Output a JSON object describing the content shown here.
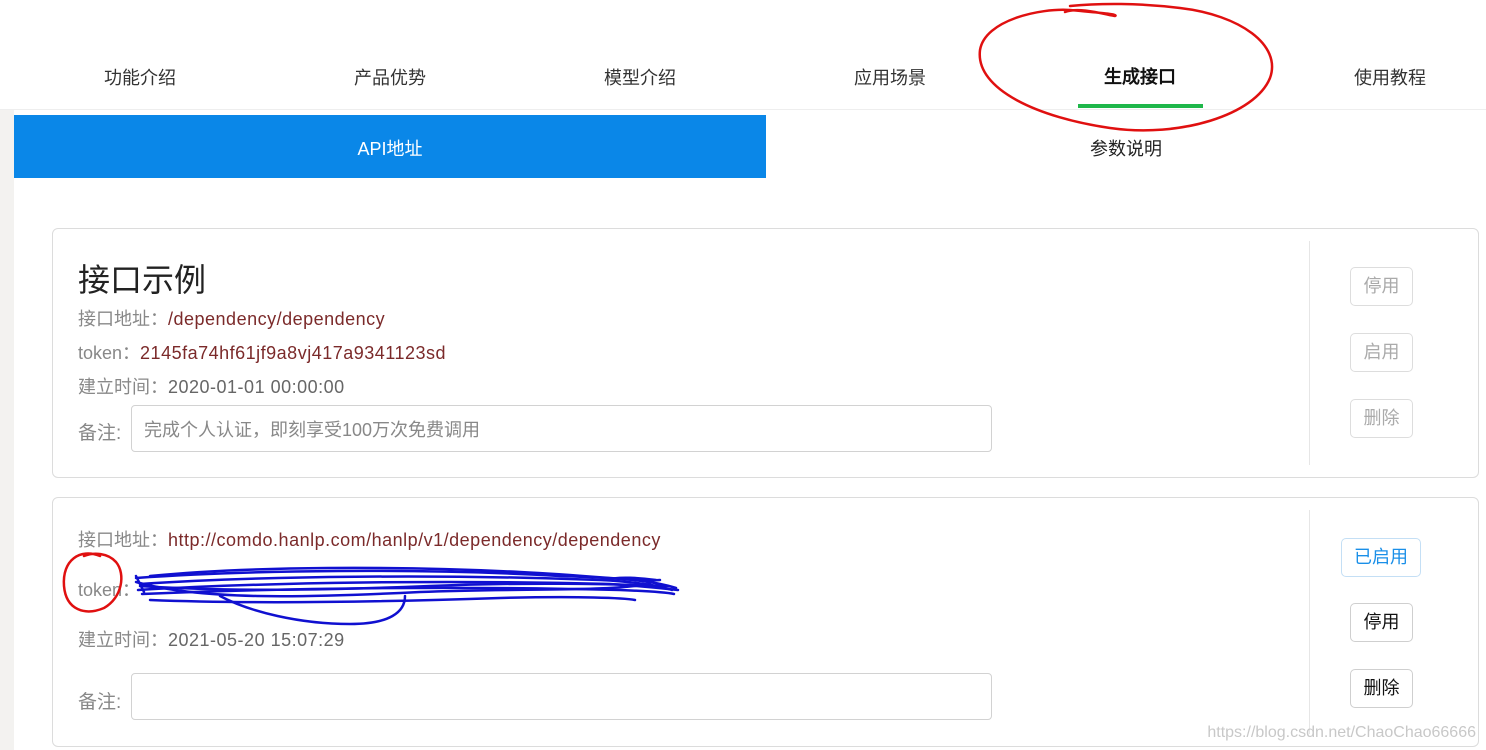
{
  "topnav": {
    "items": [
      {
        "label": "功能介绍"
      },
      {
        "label": "产品优势"
      },
      {
        "label": "模型介绍"
      },
      {
        "label": "应用场景"
      },
      {
        "label": "生成接口"
      },
      {
        "label": "使用教程"
      }
    ],
    "active_index": 4
  },
  "subtabs": {
    "api": "API地址",
    "params": "参数说明"
  },
  "cards": [
    {
      "title": "接口示例",
      "address_label": "接口地址：",
      "address": "/dependency/dependency",
      "token_label": "token：",
      "token": "2145fa74hf61jf9a8vj417a9341123sd",
      "created_label": "建立时间：",
      "created": "2020-01-01 00:00:00",
      "remark_label": "备注:",
      "remark_value": "完成个人认证，即刻享受100万次免费调用",
      "buttons": {
        "stop": "停用",
        "start": "启用",
        "delete": "删除"
      }
    },
    {
      "address_label": "接口地址：",
      "address": "http://comdo.hanlp.com/hanlp/v1/dependency/dependency",
      "token_label": "token：",
      "created_label": "建立时间：",
      "created": "2021-05-20 15:07:29",
      "remark_label": "备注:",
      "remark_value": "",
      "buttons": {
        "status": "已启用",
        "stop": "停用",
        "delete": "删除"
      }
    }
  ],
  "watermark": "https://blog.csdn.net/ChaoChao66666",
  "colors": {
    "active_tab": "#0a87e8",
    "nav_underline": "#1fb74a",
    "value_text": "#7b2a2a",
    "annotation_red": "#e01010",
    "scribble_blue": "#1010d0"
  }
}
